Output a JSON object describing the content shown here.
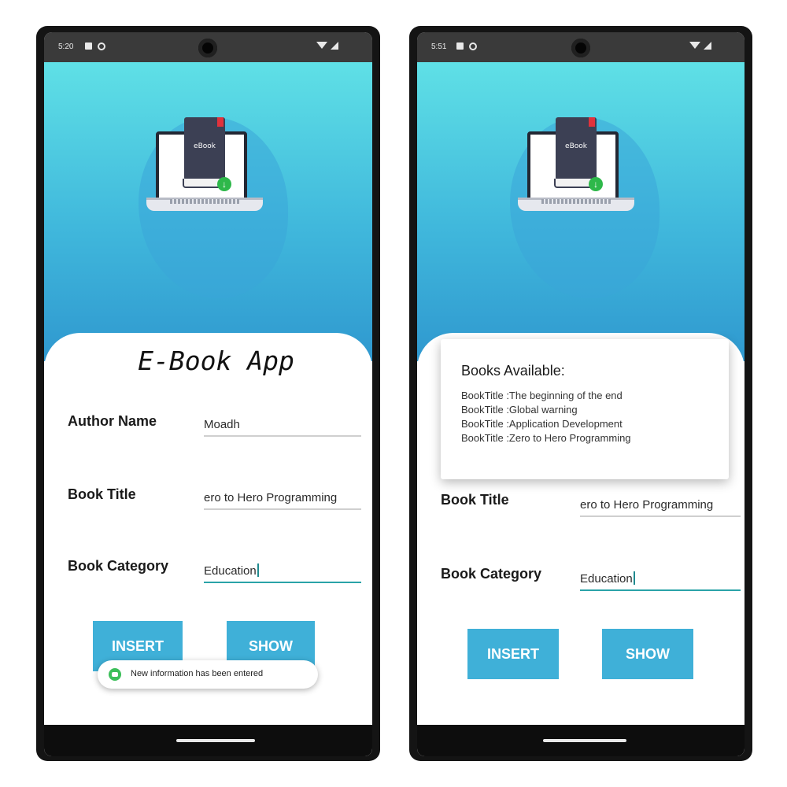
{
  "screens": {
    "left": {
      "status_time": "5:20",
      "app_title": "E-Book App",
      "book_cover_text": "eBook",
      "author_label": "Author Name",
      "author_value": "Moadh",
      "title_label": "Book Title",
      "title_value": "ero to Hero Programming",
      "category_label": "Book Category",
      "category_value": "Education",
      "insert_label": "INSERT",
      "show_label": "SHOW",
      "toast_text": "New information has been entered"
    },
    "right": {
      "status_time": "5:51",
      "book_cover_text": "eBook",
      "dialog_title": "Books Available:",
      "dialog_lines": [
        "BookTitle :The beginning of the end",
        "BookTitle :Global warning",
        "BookTitle :Application Development",
        "BookTitle :Zero to Hero Programming"
      ],
      "title_label": "Book Title",
      "title_value": "ero to Hero Programming",
      "category_label": "Book Category",
      "category_value": "Education",
      "insert_label": "INSERT",
      "show_label": "SHOW"
    }
  },
  "colors": {
    "hero_top": "#5fe0e6",
    "hero_bottom": "#2f98cf",
    "button": "#3fb0d8",
    "field_active": "#2aa3a8"
  },
  "icons": [
    "lock-icon",
    "do-not-disturb-icon",
    "camera-icon",
    "wifi-icon",
    "signal-icon",
    "laptop-ebook-illustration",
    "download-icon",
    "toast-app-icon"
  ]
}
